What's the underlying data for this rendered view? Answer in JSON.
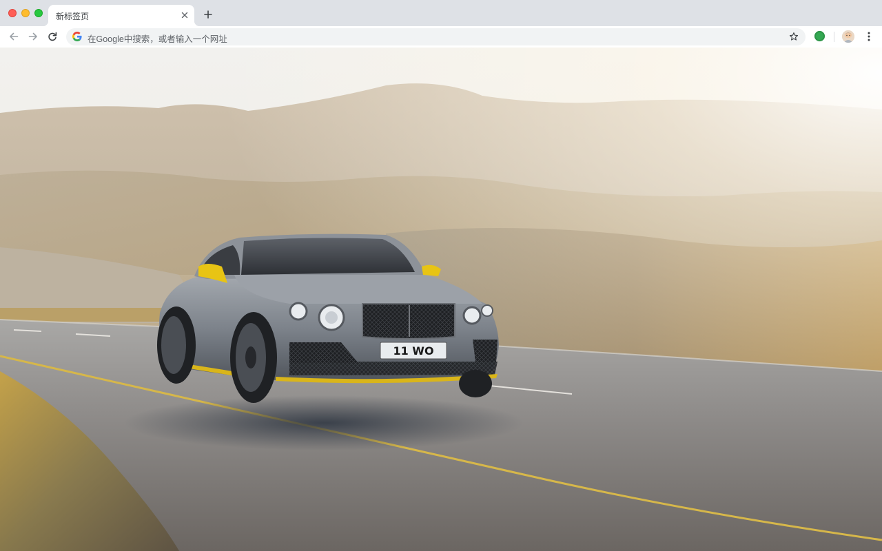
{
  "window": {
    "controls": [
      "close-window",
      "minimize-window",
      "zoom-window"
    ]
  },
  "tab": {
    "title": "新标签页",
    "close_icon": "close-icon"
  },
  "toolbar": {
    "back_icon": "arrow-left-icon",
    "forward_icon": "arrow-right-icon",
    "reload_icon": "reload-icon",
    "omnibox_placeholder": "在Google中搜索，或者输入一个网址",
    "bookmark_icon": "star-icon",
    "extension_icon": "green-circle-icon",
    "menu_icon": "more-vert-icon"
  },
  "wallpaper": {
    "license_plate": "11 WO"
  },
  "colors": {
    "tabstrip": "#dee1e6",
    "omnibox": "#f1f3f4",
    "car_accent": "#e8c414"
  }
}
